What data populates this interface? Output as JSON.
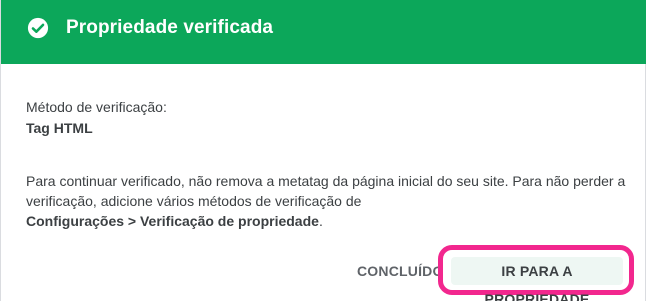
{
  "dialog": {
    "title": "Propriedade verificada",
    "method_label": "Método de verificação:",
    "method_value": "Tag HTML",
    "description_part1": "Para continuar verificado, não remova a metatag da página inicial do seu site. Para não perder a verificação, adicione vários métodos de verificação de",
    "description_bold": "Configurações > Verificação de propriedade",
    "description_end": ".",
    "buttons": {
      "done": "CONCLUÍDO",
      "go_to_property": "IR PARA A PROPRIEDADE"
    }
  },
  "colors": {
    "header_bg": "#0ca75a",
    "highlight": "#f2278e"
  },
  "icons": {
    "header": "check-circle-icon"
  }
}
